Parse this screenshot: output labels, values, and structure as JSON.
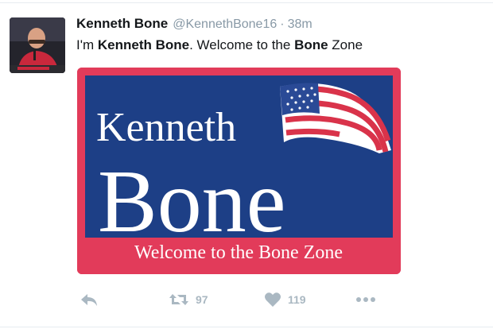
{
  "tweet": {
    "display_name": "Kenneth Bone",
    "handle": "@KennethBone16",
    "separator": "·",
    "time": "38m",
    "text_part1": "I'm ",
    "text_bold1": "Kenneth Bone",
    "text_part2": ". Welcome to the ",
    "text_bold2": "Bone",
    "text_part3": " Zone"
  },
  "media": {
    "line1": "Kenneth",
    "line2": "Bone",
    "slogan": "Welcome to the Bone Zone",
    "colors": {
      "blue": "#1d3f86",
      "red": "#e23b5a",
      "white": "#ffffff"
    }
  },
  "actions": {
    "reply_icon": "reply-icon",
    "retweet_icon": "retweet-icon",
    "retweet_count": "97",
    "like_icon": "heart-icon",
    "like_count": "119",
    "more_icon": "more-dots-icon"
  }
}
